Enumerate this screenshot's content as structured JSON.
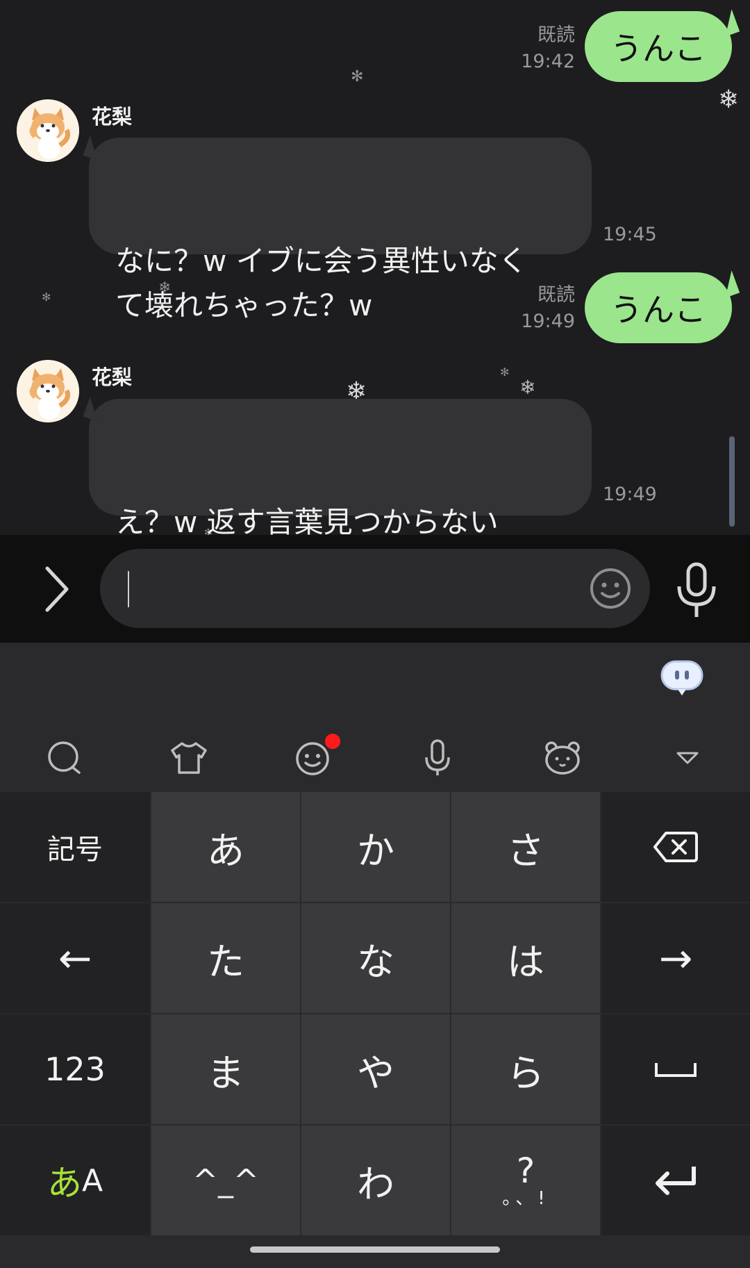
{
  "messages": [
    {
      "type": "out",
      "text": "うんこ",
      "read": "既読",
      "time": "19:42"
    },
    {
      "type": "in",
      "sender": "花梨",
      "text": "なに？w イブに会う異性いなく\nて壊れちゃった？w",
      "time": "19:45"
    },
    {
      "type": "out",
      "text": "うんこ",
      "read": "既読",
      "time": "19:49"
    },
    {
      "type": "in",
      "sender": "花梨",
      "text": "え？w 返す言葉見つからない\nよ……",
      "time": "19:49"
    }
  ],
  "input": {
    "value": ""
  },
  "icons": {
    "expand": "chevron-right-icon",
    "emoji": "smiley-icon",
    "mic": "microphone-icon",
    "assistant": "assistant-bubble-icon",
    "toolbar": [
      "search-chat-icon",
      "tshirt-theme-icon",
      "emoji-icon",
      "voice-input-icon",
      "bear-sticker-icon",
      "collapse-triangle-icon"
    ]
  },
  "keyboard": {
    "rows": [
      [
        "記号",
        "あ",
        "か",
        "さ",
        "⌫"
      ],
      [
        "←",
        "た",
        "な",
        "は",
        "→"
      ],
      [
        "123",
        "ま",
        "や",
        "ら",
        "␣"
      ],
      [
        "あA",
        "^_^",
        "わ",
        "?。、!",
        "↵"
      ]
    ],
    "mode_label_kana": "あ",
    "mode_label_latin": "A",
    "punct_main": "?",
    "punct_sub": "。、!"
  },
  "colors": {
    "out_bubble": "#9be58d",
    "in_bubble": "#333335",
    "badge": "#ff1b1b",
    "mode_kana": "#a6e23a"
  }
}
